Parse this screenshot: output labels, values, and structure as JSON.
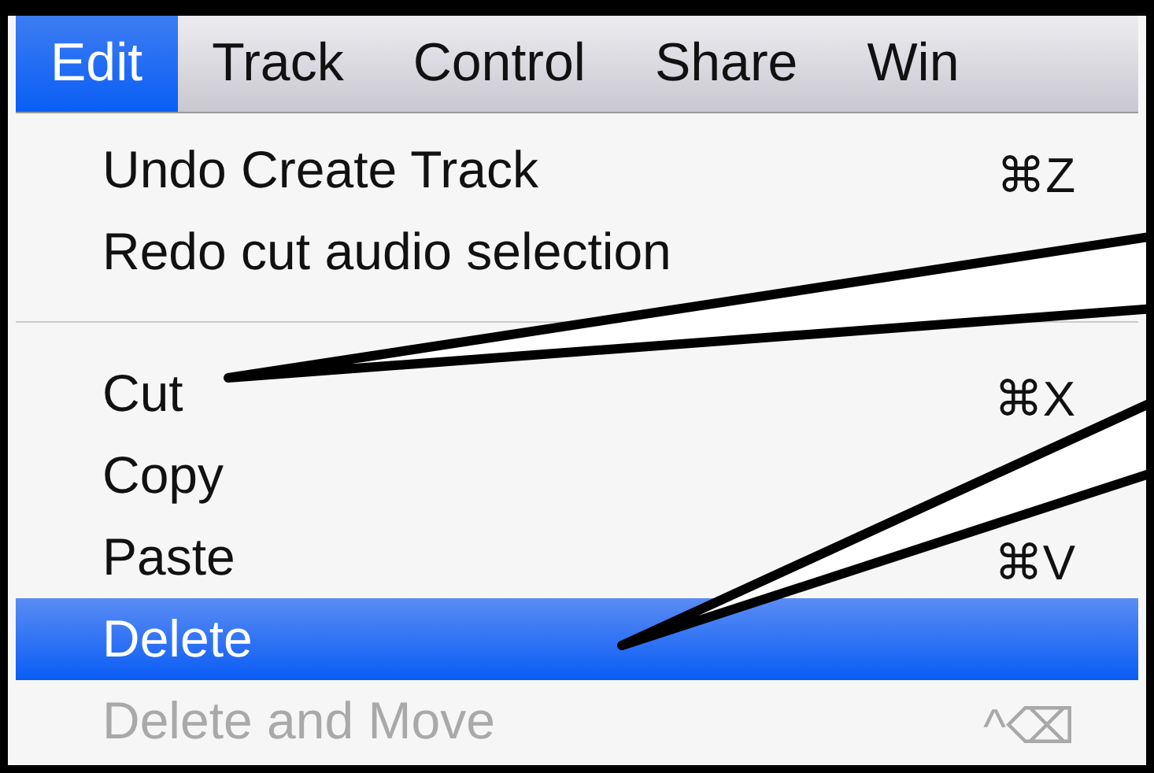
{
  "menu_bar": [
    {
      "label": "Edit",
      "selected": true
    },
    {
      "label": "Track",
      "selected": false
    },
    {
      "label": "Control",
      "selected": false
    },
    {
      "label": "Share",
      "selected": false
    },
    {
      "label": "Win",
      "selected": false
    }
  ],
  "menu": {
    "items": [
      {
        "kind": "item",
        "label": "Undo Create Track",
        "shortcut": "⌘Z",
        "selected": false,
        "disabled": false
      },
      {
        "kind": "item",
        "label": "Redo cut audio selection",
        "selected": false,
        "disabled": false
      },
      {
        "kind": "separator"
      },
      {
        "kind": "item",
        "label": "Cut",
        "shortcut": "⌘X",
        "selected": false,
        "disabled": false
      },
      {
        "kind": "item",
        "label": "Copy",
        "selected": false,
        "disabled": false
      },
      {
        "kind": "item",
        "label": "Paste",
        "shortcut": "⌘V",
        "selected": false,
        "disabled": false
      },
      {
        "kind": "item",
        "label": "Delete",
        "selected": true,
        "disabled": false
      },
      {
        "kind": "item",
        "label": "Delete and Move",
        "shortcut": "^⌫",
        "selected": false,
        "disabled": true
      }
    ]
  }
}
